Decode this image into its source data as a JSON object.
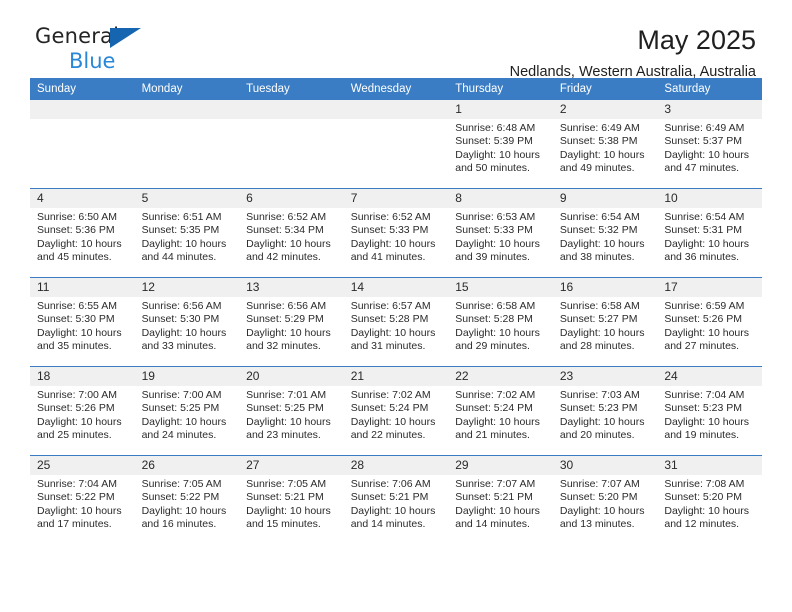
{
  "brand": {
    "line1": "General",
    "line2": "Blue",
    "triangle_color": "#1565b0",
    "blue_text_color": "#2a87d8"
  },
  "header": {
    "title": "May 2025",
    "subtitle": "Nedlands, Western Australia, Australia",
    "header_bg": "#3b7dc4"
  },
  "calendar": {
    "weekday_headers": [
      "Sunday",
      "Monday",
      "Tuesday",
      "Wednesday",
      "Thursday",
      "Friday",
      "Saturday"
    ],
    "labels": {
      "sunrise": "Sunrise:",
      "sunset": "Sunset:",
      "daylight": "Daylight:"
    },
    "weeks": [
      [
        {
          "empty": true
        },
        {
          "empty": true
        },
        {
          "empty": true
        },
        {
          "empty": true
        },
        {
          "day": "1",
          "sunrise": "Sunrise: 6:48 AM",
          "sunset": "Sunset: 5:39 PM",
          "daylight": "Daylight: 10 hours and 50 minutes."
        },
        {
          "day": "2",
          "sunrise": "Sunrise: 6:49 AM",
          "sunset": "Sunset: 5:38 PM",
          "daylight": "Daylight: 10 hours and 49 minutes."
        },
        {
          "day": "3",
          "sunrise": "Sunrise: 6:49 AM",
          "sunset": "Sunset: 5:37 PM",
          "daylight": "Daylight: 10 hours and 47 minutes."
        }
      ],
      [
        {
          "day": "4",
          "sunrise": "Sunrise: 6:50 AM",
          "sunset": "Sunset: 5:36 PM",
          "daylight": "Daylight: 10 hours and 45 minutes."
        },
        {
          "day": "5",
          "sunrise": "Sunrise: 6:51 AM",
          "sunset": "Sunset: 5:35 PM",
          "daylight": "Daylight: 10 hours and 44 minutes."
        },
        {
          "day": "6",
          "sunrise": "Sunrise: 6:52 AM",
          "sunset": "Sunset: 5:34 PM",
          "daylight": "Daylight: 10 hours and 42 minutes."
        },
        {
          "day": "7",
          "sunrise": "Sunrise: 6:52 AM",
          "sunset": "Sunset: 5:33 PM",
          "daylight": "Daylight: 10 hours and 41 minutes."
        },
        {
          "day": "8",
          "sunrise": "Sunrise: 6:53 AM",
          "sunset": "Sunset: 5:33 PM",
          "daylight": "Daylight: 10 hours and 39 minutes."
        },
        {
          "day": "9",
          "sunrise": "Sunrise: 6:54 AM",
          "sunset": "Sunset: 5:32 PM",
          "daylight": "Daylight: 10 hours and 38 minutes."
        },
        {
          "day": "10",
          "sunrise": "Sunrise: 6:54 AM",
          "sunset": "Sunset: 5:31 PM",
          "daylight": "Daylight: 10 hours and 36 minutes."
        }
      ],
      [
        {
          "day": "11",
          "sunrise": "Sunrise: 6:55 AM",
          "sunset": "Sunset: 5:30 PM",
          "daylight": "Daylight: 10 hours and 35 minutes."
        },
        {
          "day": "12",
          "sunrise": "Sunrise: 6:56 AM",
          "sunset": "Sunset: 5:30 PM",
          "daylight": "Daylight: 10 hours and 33 minutes."
        },
        {
          "day": "13",
          "sunrise": "Sunrise: 6:56 AM",
          "sunset": "Sunset: 5:29 PM",
          "daylight": "Daylight: 10 hours and 32 minutes."
        },
        {
          "day": "14",
          "sunrise": "Sunrise: 6:57 AM",
          "sunset": "Sunset: 5:28 PM",
          "daylight": "Daylight: 10 hours and 31 minutes."
        },
        {
          "day": "15",
          "sunrise": "Sunrise: 6:58 AM",
          "sunset": "Sunset: 5:28 PM",
          "daylight": "Daylight: 10 hours and 29 minutes."
        },
        {
          "day": "16",
          "sunrise": "Sunrise: 6:58 AM",
          "sunset": "Sunset: 5:27 PM",
          "daylight": "Daylight: 10 hours and 28 minutes."
        },
        {
          "day": "17",
          "sunrise": "Sunrise: 6:59 AM",
          "sunset": "Sunset: 5:26 PM",
          "daylight": "Daylight: 10 hours and 27 minutes."
        }
      ],
      [
        {
          "day": "18",
          "sunrise": "Sunrise: 7:00 AM",
          "sunset": "Sunset: 5:26 PM",
          "daylight": "Daylight: 10 hours and 25 minutes."
        },
        {
          "day": "19",
          "sunrise": "Sunrise: 7:00 AM",
          "sunset": "Sunset: 5:25 PM",
          "daylight": "Daylight: 10 hours and 24 minutes."
        },
        {
          "day": "20",
          "sunrise": "Sunrise: 7:01 AM",
          "sunset": "Sunset: 5:25 PM",
          "daylight": "Daylight: 10 hours and 23 minutes."
        },
        {
          "day": "21",
          "sunrise": "Sunrise: 7:02 AM",
          "sunset": "Sunset: 5:24 PM",
          "daylight": "Daylight: 10 hours and 22 minutes."
        },
        {
          "day": "22",
          "sunrise": "Sunrise: 7:02 AM",
          "sunset": "Sunset: 5:24 PM",
          "daylight": "Daylight: 10 hours and 21 minutes."
        },
        {
          "day": "23",
          "sunrise": "Sunrise: 7:03 AM",
          "sunset": "Sunset: 5:23 PM",
          "daylight": "Daylight: 10 hours and 20 minutes."
        },
        {
          "day": "24",
          "sunrise": "Sunrise: 7:04 AM",
          "sunset": "Sunset: 5:23 PM",
          "daylight": "Daylight: 10 hours and 19 minutes."
        }
      ],
      [
        {
          "day": "25",
          "sunrise": "Sunrise: 7:04 AM",
          "sunset": "Sunset: 5:22 PM",
          "daylight": "Daylight: 10 hours and 17 minutes."
        },
        {
          "day": "26",
          "sunrise": "Sunrise: 7:05 AM",
          "sunset": "Sunset: 5:22 PM",
          "daylight": "Daylight: 10 hours and 16 minutes."
        },
        {
          "day": "27",
          "sunrise": "Sunrise: 7:05 AM",
          "sunset": "Sunset: 5:21 PM",
          "daylight": "Daylight: 10 hours and 15 minutes."
        },
        {
          "day": "28",
          "sunrise": "Sunrise: 7:06 AM",
          "sunset": "Sunset: 5:21 PM",
          "daylight": "Daylight: 10 hours and 14 minutes."
        },
        {
          "day": "29",
          "sunrise": "Sunrise: 7:07 AM",
          "sunset": "Sunset: 5:21 PM",
          "daylight": "Daylight: 10 hours and 14 minutes."
        },
        {
          "day": "30",
          "sunrise": "Sunrise: 7:07 AM",
          "sunset": "Sunset: 5:20 PM",
          "daylight": "Daylight: 10 hours and 13 minutes."
        },
        {
          "day": "31",
          "sunrise": "Sunrise: 7:08 AM",
          "sunset": "Sunset: 5:20 PM",
          "daylight": "Daylight: 10 hours and 12 minutes."
        }
      ]
    ]
  }
}
